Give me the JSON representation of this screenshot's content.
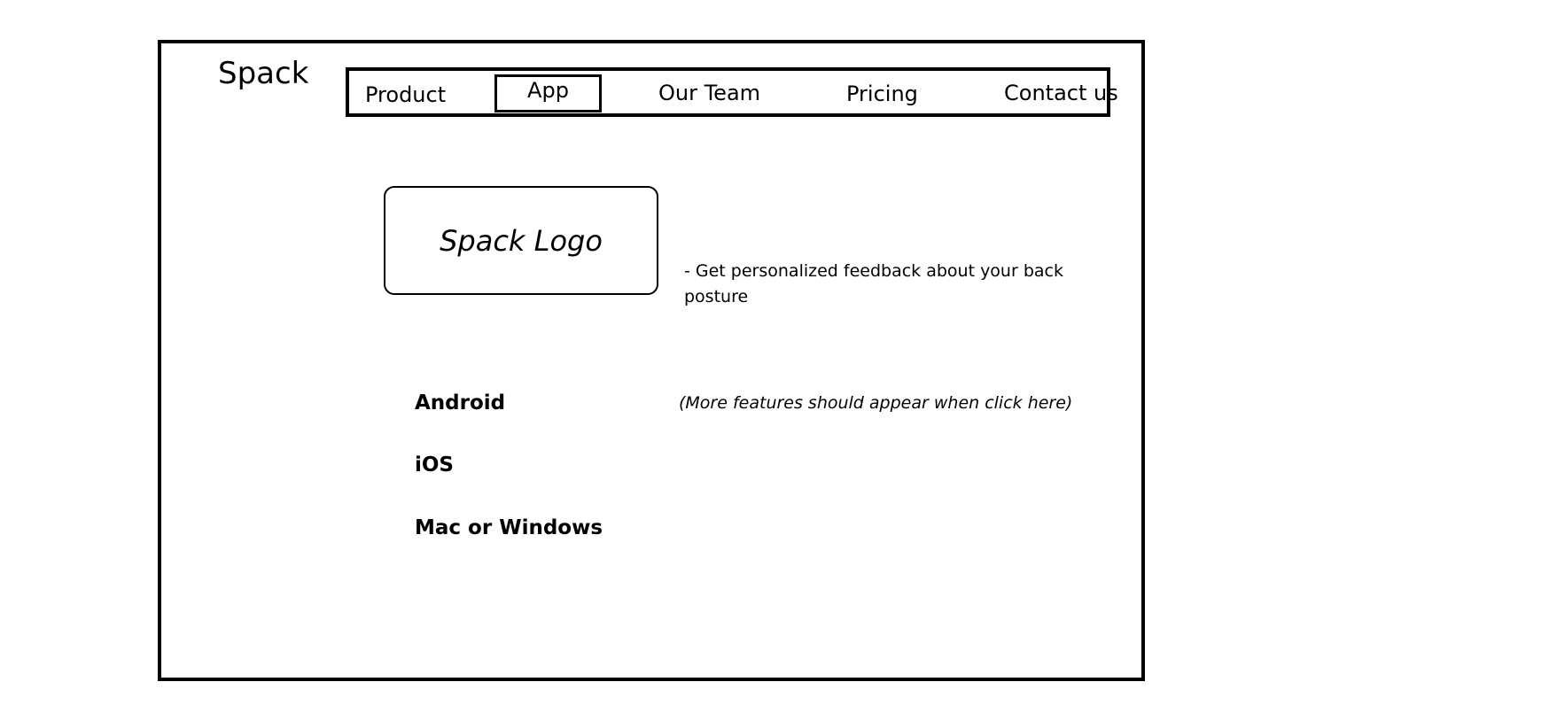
{
  "header": {
    "brand": "Spack"
  },
  "nav": {
    "items": [
      {
        "label": "Product"
      },
      {
        "label": "App",
        "selected": true
      },
      {
        "label": "Our Team"
      },
      {
        "label": "Pricing"
      },
      {
        "label": "Contact us"
      }
    ]
  },
  "main": {
    "logo_placeholder": "Spack Logo",
    "feature_text": "- Get personalized feedback about your back posture",
    "platforms": [
      {
        "label": "Android"
      },
      {
        "label": "iOS"
      },
      {
        "label": "Mac or Windows"
      }
    ],
    "note": "(More features should appear when click here)"
  }
}
